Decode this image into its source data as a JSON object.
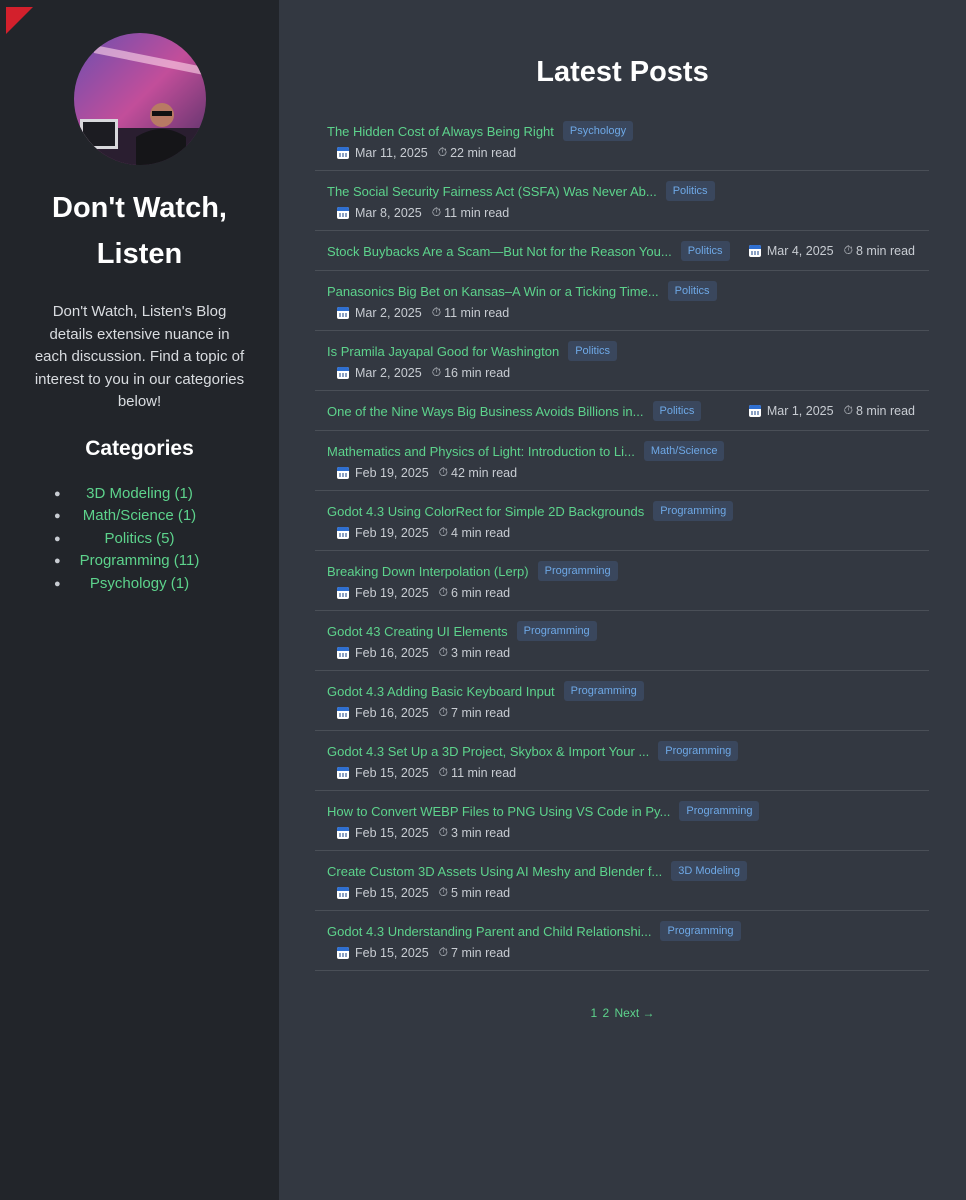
{
  "sidebar": {
    "title": "Don't Watch, Listen",
    "description": "Don't Watch, Listen's Blog details extensive nuance in each discussion. Find a topic of interest to you in our categories below!",
    "categories_heading": "Categories",
    "categories": [
      {
        "label": "3D Modeling (1)"
      },
      {
        "label": "Math/Science (1)"
      },
      {
        "label": "Politics (5)"
      },
      {
        "label": "Programming (11)"
      },
      {
        "label": "Psychology (1)"
      }
    ]
  },
  "main": {
    "heading": "Latest Posts",
    "posts": [
      {
        "title": "The Hidden Cost of Always Being Right",
        "tag": "Psychology",
        "date": "Mar 11, 2025",
        "read": "22 min read"
      },
      {
        "title": "The Social Security Fairness Act (SSFA) Was Never Ab...",
        "tag": "Politics",
        "date": "Mar 8, 2025",
        "read": "11 min read"
      },
      {
        "title": "Stock Buybacks Are a Scam—But Not for the Reason You...",
        "tag": "Politics",
        "date": "Mar 4, 2025",
        "read": "8 min read"
      },
      {
        "title": "Panasonics Big Bet on Kansas–A Win or a Ticking Time...",
        "tag": "Politics",
        "date": "Mar 2, 2025",
        "read": "11 min read"
      },
      {
        "title": "Is Pramila Jayapal Good for Washington",
        "tag": "Politics",
        "date": "Mar 2, 2025",
        "read": "16 min read"
      },
      {
        "title": "One of the Nine Ways Big Business Avoids Billions in...",
        "tag": "Politics",
        "date": "Mar 1, 2025",
        "read": "8 min read"
      },
      {
        "title": "Mathematics and Physics of Light: Introduction to Li...",
        "tag": "Math/Science",
        "date": "Feb 19, 2025",
        "read": "42 min read"
      },
      {
        "title": "Godot 4.3 Using ColorRect for Simple 2D Backgrounds",
        "tag": "Programming",
        "date": "Feb 19, 2025",
        "read": "4 min read"
      },
      {
        "title": "Breaking Down Interpolation (Lerp)",
        "tag": "Programming",
        "date": "Feb 19, 2025",
        "read": "6 min read"
      },
      {
        "title": "Godot 43 Creating UI Elements",
        "tag": "Programming",
        "date": "Feb 16, 2025",
        "read": "3 min read"
      },
      {
        "title": "Godot 4.3 Adding Basic Keyboard Input",
        "tag": "Programming",
        "date": "Feb 16, 2025",
        "read": "7 min read"
      },
      {
        "title": "Godot 4.3 Set Up a 3D Project, Skybox & Import Your ...",
        "tag": "Programming",
        "date": "Feb 15, 2025",
        "read": "11 min read"
      },
      {
        "title": "How to Convert WEBP Files to PNG Using VS Code in Py...",
        "tag": "Programming",
        "date": "Feb 15, 2025",
        "read": "3 min read"
      },
      {
        "title": "Create Custom 3D Assets Using AI Meshy and Blender f...",
        "tag": "3D Modeling",
        "date": "Feb 15, 2025",
        "read": "5 min read"
      },
      {
        "title": "Godot 4.3 Understanding Parent and Child Relationshi...",
        "tag": "Programming",
        "date": "Feb 15, 2025",
        "read": "7 min read"
      }
    ],
    "pagination": {
      "page1": "1",
      "page2": "2",
      "next": "Next →"
    }
  },
  "icons": {
    "calendar": "calendar-icon",
    "clock": "⏱"
  },
  "colors": {
    "link": "#5dd38c",
    "tag_text": "#6ea8e6",
    "tag_bg": "#3a475d",
    "accent": "#d3202c"
  }
}
